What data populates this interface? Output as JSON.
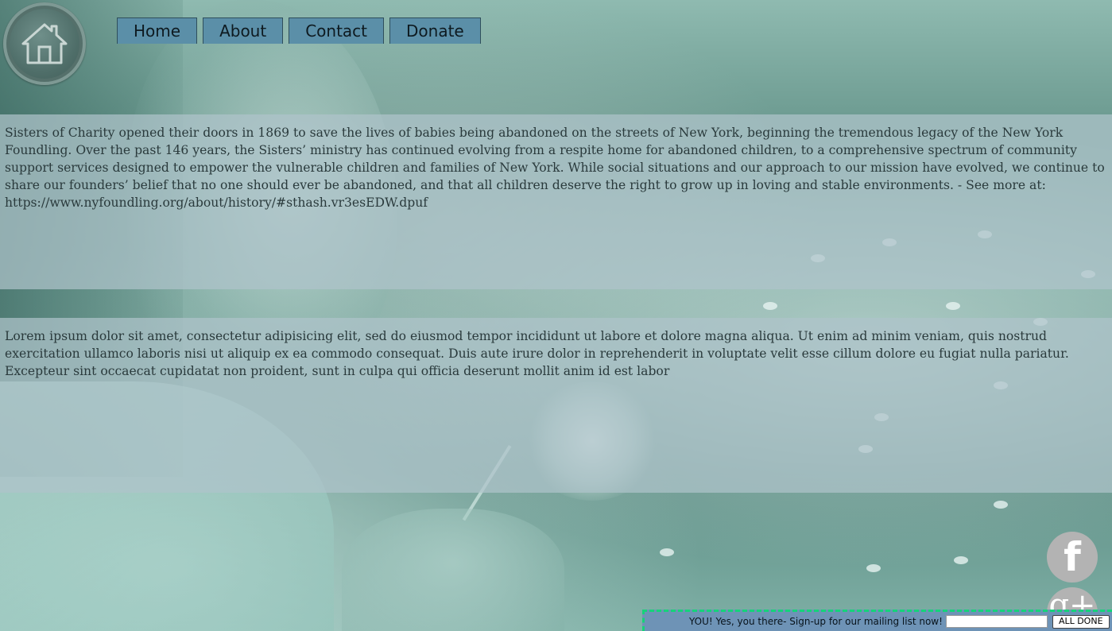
{
  "header": {
    "home_icon": "house-icon",
    "nav": [
      {
        "label": "Home"
      },
      {
        "label": "About"
      },
      {
        "label": "Contact"
      },
      {
        "label": "Donate"
      }
    ]
  },
  "sections": {
    "history": "Sisters of Charity opened their doors in 1869 to save the lives of babies being abandoned on the streets of New York, beginning the tremendous legacy of the New York Foundling. Over the past 146 years, the Sisters’ ministry has continued evolving from a respite home for abandoned children, to a comprehensive spectrum of community support services designed to empower the vulnerable children and families of New York. While social situations and our approach to our mission have evolved, we continue to share our founders’ belief that no one should ever be abandoned, and that all children deserve the right to grow up in loving and stable environments. - See more at: https://www.nyfoundling.org/about/history/#sthash.vr3esEDW.dpuf",
    "lorem": "Lorem ipsum dolor sit amet, consectetur adipisicing elit, sed do eiusmod tempor incididunt ut labore et dolore magna aliqua. Ut enim ad minim veniam, quis nostrud exercitation ullamco laboris nisi ut aliquip ex ea commodo consequat. Duis aute irure dolor in reprehenderit in voluptate velit esse cillum dolore eu fugiat nulla pariatur. Excepteur sint occaecat cupidatat non proident, sunt in culpa qui officia deserunt mollit anim id est labor"
  },
  "social": {
    "facebook_glyph": "f",
    "facebook_icon": "facebook-icon",
    "gplus_glyph": "g+",
    "gplus_icon": "google-plus-icon"
  },
  "mailing": {
    "text": "YOU! Yes, you there- Sign-up for our mailing list now!",
    "input_value": "",
    "button_label": "ALL DONE"
  },
  "colors": {
    "nav_button": "#5b8fa8",
    "panel_overlay": "#afc3ca",
    "mail_bar": "#6e93b6",
    "mail_border": "#16d27a",
    "social_circle": "#b3b3b3"
  }
}
